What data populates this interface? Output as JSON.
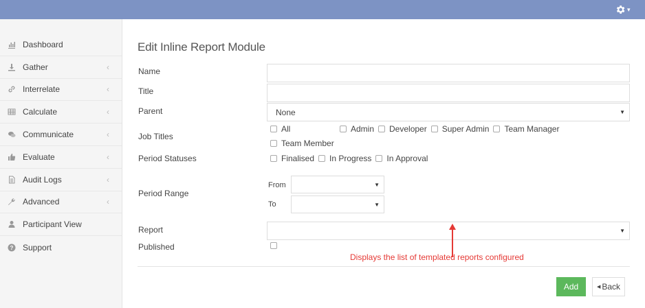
{
  "header": {
    "settings_icon": "gear-icon",
    "bg_color": "#7d93c4"
  },
  "sidebar": {
    "items": [
      {
        "label": "Dashboard",
        "icon": "bar-chart-icon",
        "has_arrow": false
      },
      {
        "label": "Gather",
        "icon": "download-icon",
        "has_arrow": true
      },
      {
        "label": "Interrelate",
        "icon": "link-icon",
        "has_arrow": true
      },
      {
        "label": "Calculate",
        "icon": "table-icon",
        "has_arrow": true
      },
      {
        "label": "Communicate",
        "icon": "comments-icon",
        "has_arrow": true
      },
      {
        "label": "Evaluate",
        "icon": "thumbs-up-icon",
        "has_arrow": true
      },
      {
        "label": "Audit Logs",
        "icon": "file-icon",
        "has_arrow": true
      },
      {
        "label": "Advanced",
        "icon": "wrench-icon",
        "has_arrow": true
      },
      {
        "label": "Participant View",
        "icon": "user-icon",
        "has_arrow": false
      },
      {
        "label": "Support",
        "icon": "question-circle-icon",
        "has_arrow": false
      }
    ],
    "arrow_glyph": "‹"
  },
  "form": {
    "title": "Edit Inline Report Module",
    "name_label": "Name",
    "name_value": "",
    "title_label": "Title",
    "title_value": "",
    "parent_label": "Parent",
    "parent_value": "None",
    "job_titles_label": "Job Titles",
    "job_titles": [
      "All",
      "Admin",
      "Developer",
      "Super Admin",
      "Team Manager",
      "Team Member"
    ],
    "period_statuses_label": "Period Statuses",
    "period_statuses": [
      "Finalised",
      "In Progress",
      "In Approval"
    ],
    "period_range_label": "Period Range",
    "from_label": "From",
    "to_label": "To",
    "report_label": "Report",
    "report_value": "",
    "published_label": "Published",
    "annotation": "Displays the list of templated reports configured",
    "annotation_color": "#e53935",
    "add_label": "Add",
    "back_label": "Back",
    "add_color": "#5cb85c"
  }
}
